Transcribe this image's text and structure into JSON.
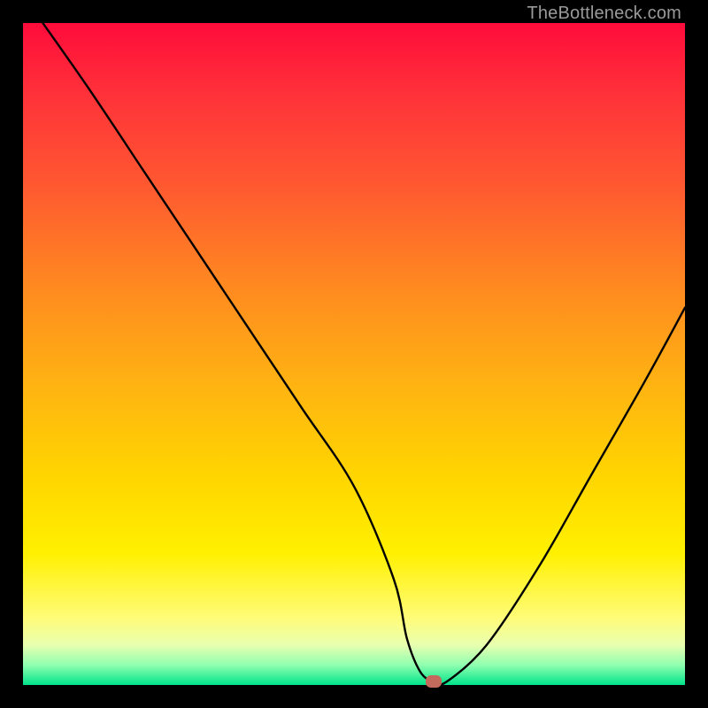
{
  "attribution": "TheBottleneck.com",
  "chart_data": {
    "type": "line",
    "title": "",
    "xlabel": "",
    "ylabel": "",
    "xlim": [
      0,
      100
    ],
    "ylim": [
      0,
      100
    ],
    "grid": false,
    "legend": false,
    "series": [
      {
        "name": "bottleneck-curve",
        "x": [
          3,
          10,
          18,
          26,
          34,
          42,
          50,
          56,
          58,
          60,
          62,
          64,
          70,
          78,
          86,
          94,
          100
        ],
        "y": [
          100,
          90,
          78,
          66,
          54,
          42,
          30,
          16,
          7,
          2,
          0.5,
          0.5,
          6,
          18,
          32,
          46,
          57
        ]
      }
    ],
    "marker": {
      "x": 62,
      "y": 0.5,
      "color": "#c46a5c"
    },
    "gradient_stops": [
      {
        "pos": 0,
        "color": "#ff0b3b"
      },
      {
        "pos": 10,
        "color": "#ff2f3a"
      },
      {
        "pos": 25,
        "color": "#ff5a30"
      },
      {
        "pos": 40,
        "color": "#ff8a20"
      },
      {
        "pos": 55,
        "color": "#ffb412"
      },
      {
        "pos": 68,
        "color": "#ffd400"
      },
      {
        "pos": 80,
        "color": "#fff000"
      },
      {
        "pos": 90,
        "color": "#fffc7a"
      },
      {
        "pos": 94,
        "color": "#e8ffb0"
      },
      {
        "pos": 97,
        "color": "#8fffb0"
      },
      {
        "pos": 100,
        "color": "#00e38a"
      }
    ]
  }
}
